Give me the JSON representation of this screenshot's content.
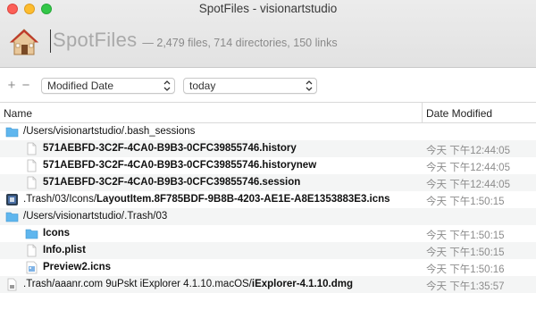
{
  "window": {
    "title": "SpotFiles - visionartstudio"
  },
  "search": {
    "value": "SpotFiles",
    "stats": "— 2,479 files, 714 directories, 150 links"
  },
  "criteria": {
    "add_label": "+",
    "remove_label": "−",
    "attribute": "Modified Date",
    "value": "today"
  },
  "columns": {
    "name": "Name",
    "date": "Date Modified"
  },
  "rows": [
    {
      "icon": "folder-icon",
      "indent": 0,
      "prefix": "/Users/visionartstudio/.bash_sessions",
      "name": "",
      "date": ""
    },
    {
      "icon": "document-icon",
      "indent": 1,
      "prefix": "",
      "name": "571AEBFD-3C2F-4CA0-B9B3-0CFC39855746.history",
      "date": "今天 下午12:44:05"
    },
    {
      "icon": "document-icon",
      "indent": 1,
      "prefix": "",
      "name": "571AEBFD-3C2F-4CA0-B9B3-0CFC39855746.historynew",
      "date": "今天 下午12:44:05"
    },
    {
      "icon": "document-icon",
      "indent": 1,
      "prefix": "",
      "name": "571AEBFD-3C2F-4CA0-B9B3-0CFC39855746.session",
      "date": "今天 下午12:44:05"
    },
    {
      "icon": "app-icon-file",
      "indent": 0,
      "prefix": ".Trash/03/Icons/",
      "name": "LayoutItem.8F785BDF-9B8B-4203-AE1E-A8E1353883E3.icns",
      "date": "今天 下午1:50:15"
    },
    {
      "icon": "folder-icon",
      "indent": 0,
      "prefix": "/Users/visionartstudio/.Trash/03",
      "name": "",
      "date": ""
    },
    {
      "icon": "folder-icon",
      "indent": 1,
      "prefix": "",
      "name": "Icons",
      "date": "今天 下午1:50:15"
    },
    {
      "icon": "document-icon",
      "indent": 1,
      "prefix": "",
      "name": "Info.plist",
      "date": "今天 下午1:50:15"
    },
    {
      "icon": "image-file-icon",
      "indent": 1,
      "prefix": "",
      "name": "Preview2.icns",
      "date": "今天 下午1:50:16"
    },
    {
      "icon": "dmg-file-icon",
      "indent": 0,
      "prefix": ".Trash/aaanr.com 9uPskt iExplorer 4.1.10.macOS/",
      "name": "iExplorer-4.1.10.dmg",
      "date": "今天 下午1:35:57"
    }
  ],
  "colors": {
    "folder": "#5fb6ee",
    "alt_row": "#f4f5f5"
  }
}
